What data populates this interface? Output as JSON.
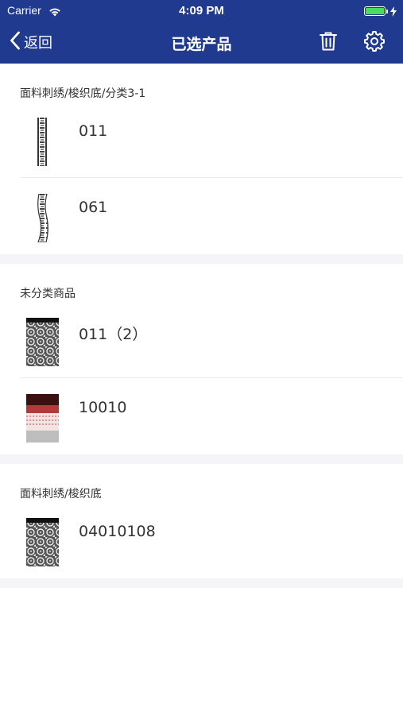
{
  "status_bar": {
    "carrier": "Carrier",
    "time": "4:09 PM"
  },
  "nav": {
    "back_label": "返回",
    "title": "已选产品"
  },
  "sections": [
    {
      "title": "面料刺绣/梭织底/分类3-1",
      "items": [
        {
          "label": "011",
          "thumb": "lace-strip-thumbnail"
        },
        {
          "label": "061",
          "thumb": "lace-strip-wavy-thumbnail"
        }
      ]
    },
    {
      "title": "未分类商品",
      "items": [
        {
          "label": "011（2）",
          "thumb": "floral-lace-thumbnail"
        },
        {
          "label": "10010",
          "thumb": "red-lace-thumbnail"
        }
      ]
    },
    {
      "title": "面料刺绣/梭织底",
      "items": [
        {
          "label": "04010108",
          "thumb": "floral-lace-thumbnail"
        }
      ]
    }
  ],
  "colors": {
    "nav_bar": "#1f3a8f",
    "battery": "#4cd964",
    "section_gap": "#f5f5f7"
  }
}
